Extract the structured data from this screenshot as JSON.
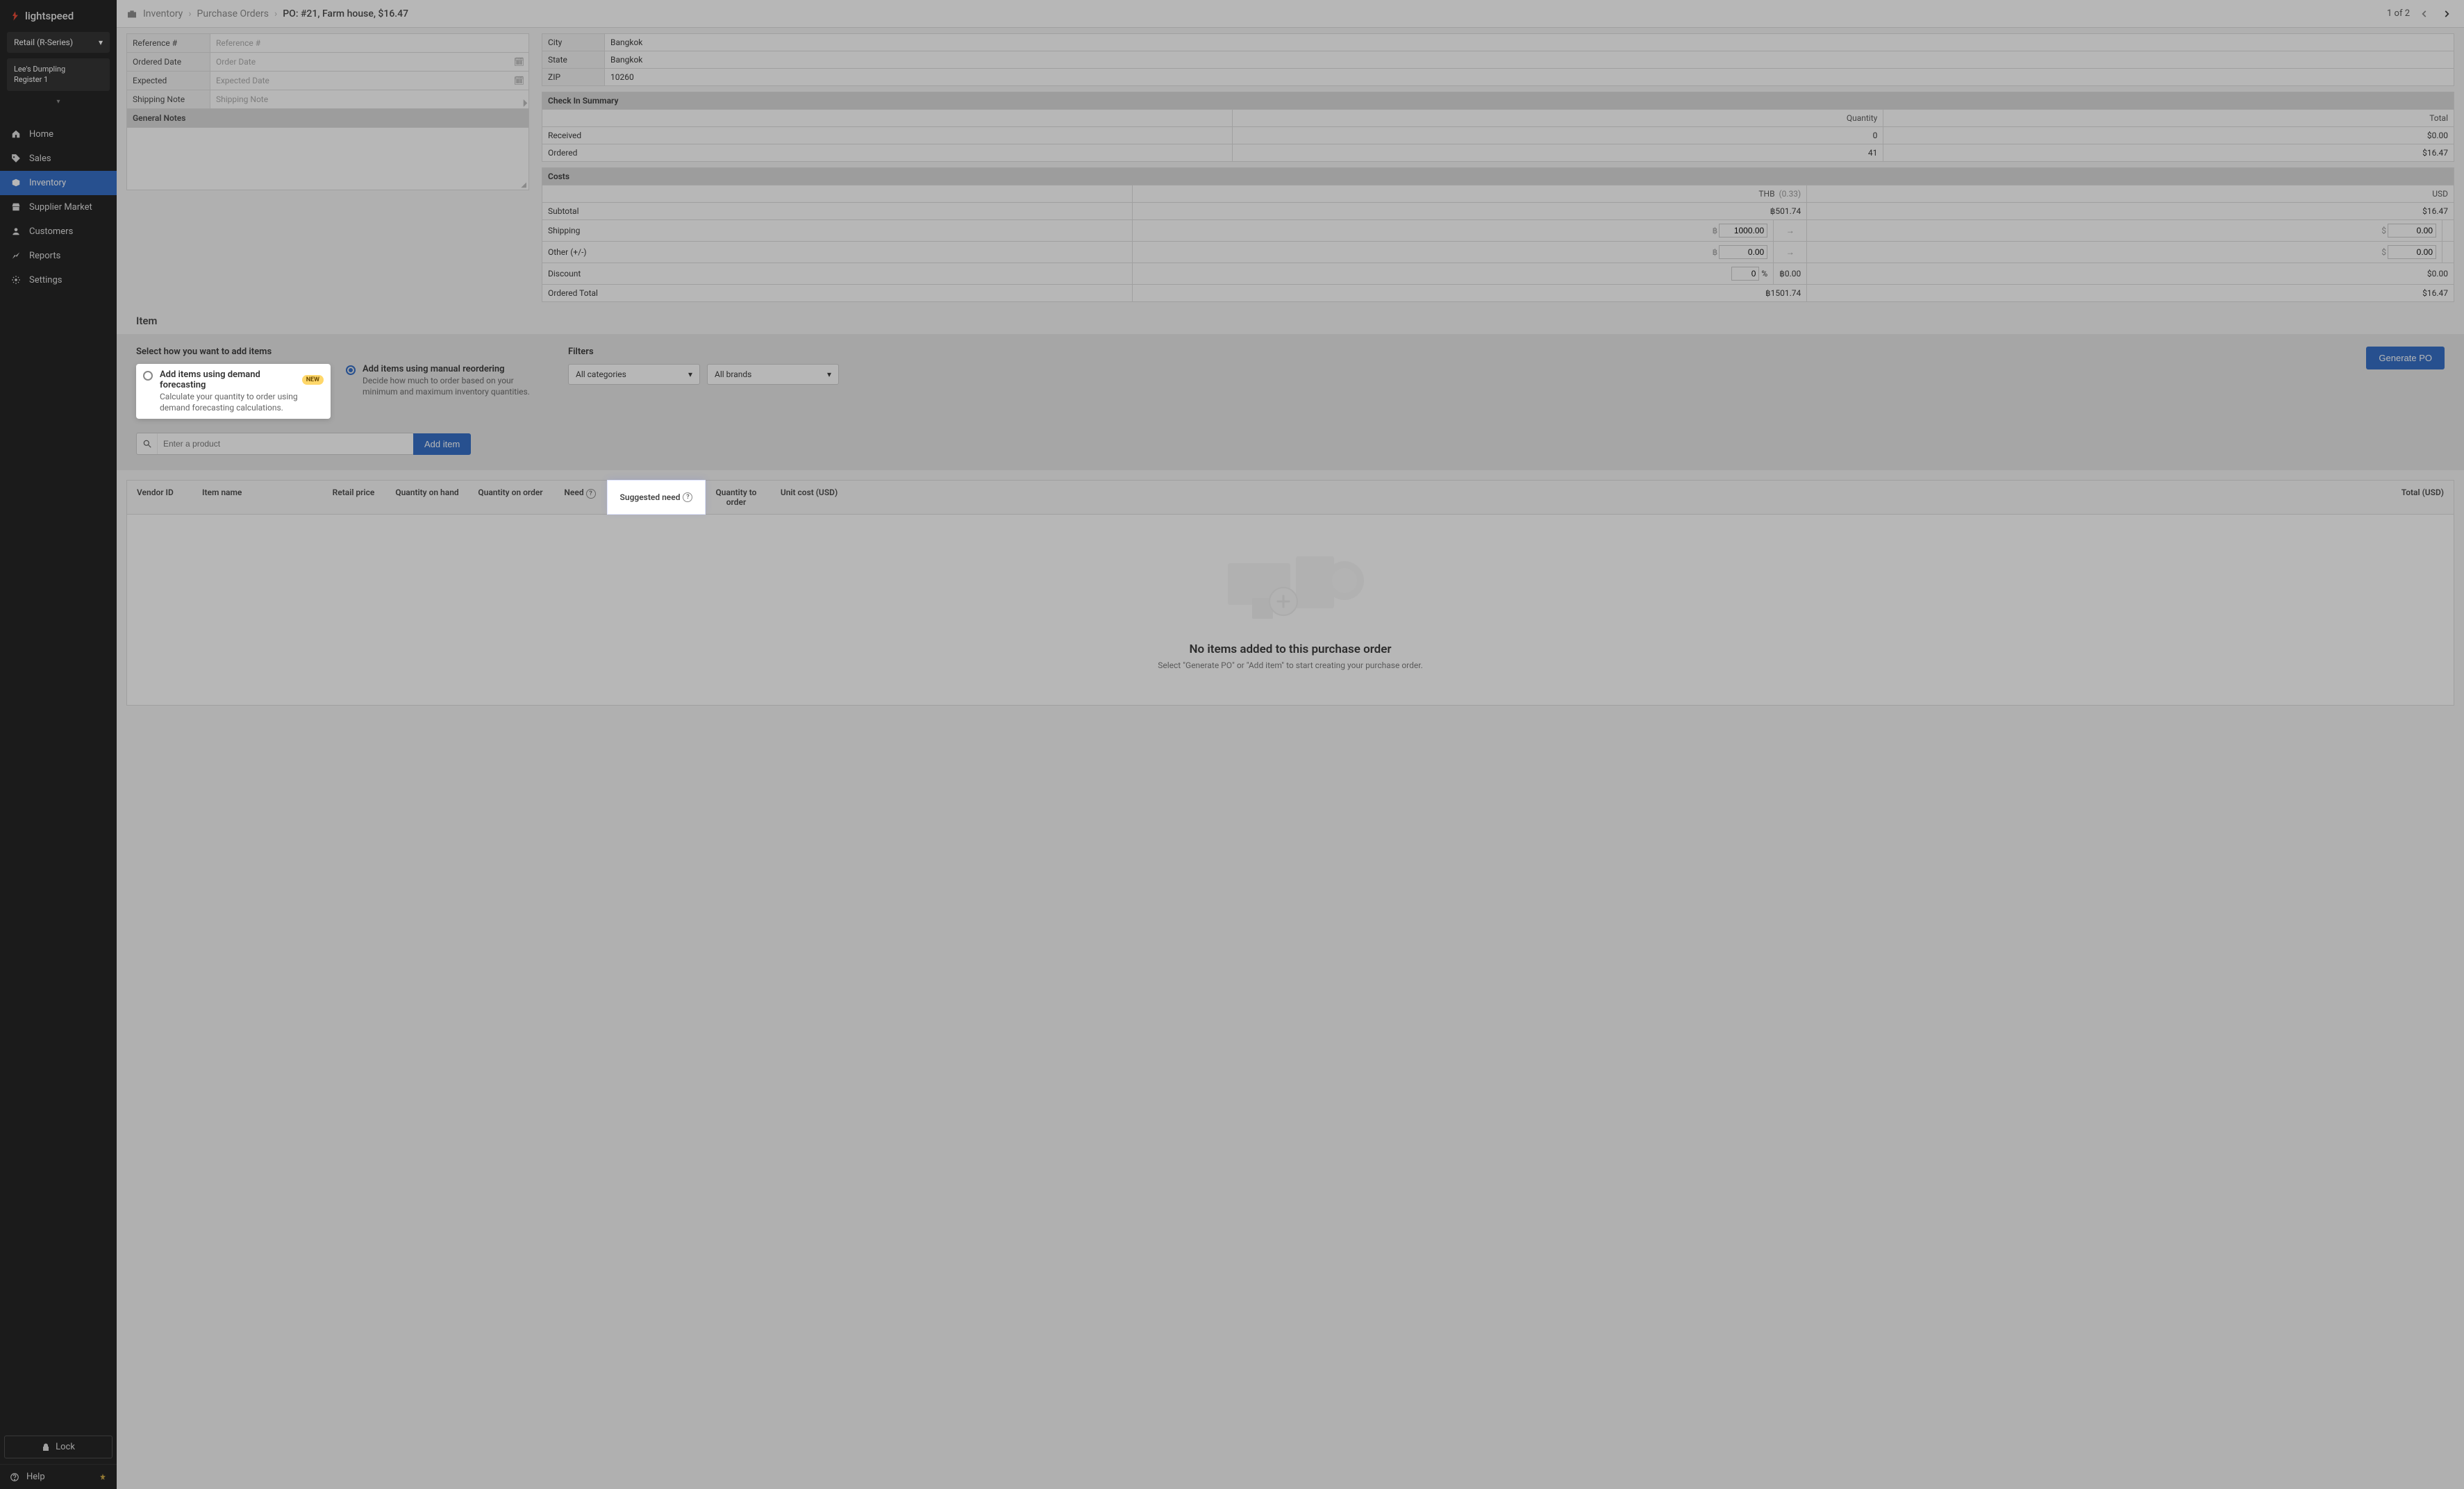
{
  "brand": "lightspeed",
  "retail_dropdown": "Retail (R-Series)",
  "location_name": "Lee's Dumpling",
  "register_name": "Register 1",
  "nav": {
    "home": "Home",
    "sales": "Sales",
    "inventory": "Inventory",
    "supplier_market": "Supplier Market",
    "customers": "Customers",
    "reports": "Reports",
    "settings": "Settings"
  },
  "lock": "Lock",
  "help": "Help",
  "breadcrumbs": {
    "inventory": "Inventory",
    "purchase_orders": "Purchase Orders",
    "current": "PO:  #21, Farm house, $16.47"
  },
  "pagination": "1 of 2",
  "form": {
    "ref_label": "Reference #",
    "ref_placeholder": "Reference #",
    "ordered_label": "Ordered Date",
    "ordered_placeholder": "Order Date",
    "expected_label": "Expected",
    "expected_placeholder": "Expected Date",
    "ship_note_label": "Shipping Note",
    "ship_note_placeholder": "Shipping Note",
    "general_notes_label": "General Notes"
  },
  "address": {
    "city_label": "City",
    "city": "Bangkok",
    "state_label": "State",
    "state": "Bangkok",
    "zip_label": "ZIP",
    "zip": "10260"
  },
  "checkin": {
    "header": "Check In Summary",
    "qty_label": "Quantity",
    "total_label": "Total",
    "received_label": "Received",
    "received_qty": "0",
    "received_total": "$0.00",
    "ordered_label": "Ordered",
    "ordered_qty": "41",
    "ordered_total": "$16.47"
  },
  "costs": {
    "header": "Costs",
    "thb": "THB",
    "thb_rate": "(0.33)",
    "usd": "USD",
    "subtotal_label": "Subtotal",
    "subtotal_thb": "฿501.74",
    "subtotal_usd": "$16.47",
    "shipping_label": "Shipping",
    "shipping_thb": "1000.00",
    "shipping_usd": "0.00",
    "other_label": "Other (+/-)",
    "other_thb": "0.00",
    "other_usd": "0.00",
    "discount_label": "Discount",
    "discount_val": "0",
    "discount_pct": "%",
    "discount_thb": "฿0.00",
    "discount_usd": "$0.00",
    "ordered_total_label": "Ordered Total",
    "ordered_total_thb": "฿1501.74",
    "ordered_total_usd": "$16.47"
  },
  "item_section": {
    "heading": "Item",
    "select_heading": "Select how you want to add items",
    "opt_forecast_title": "Add items using demand forecasting",
    "opt_forecast_badge": "NEW",
    "opt_forecast_desc": "Calculate your quantity to order using demand forecasting calculations.",
    "opt_manual_title": "Add items using manual reordering",
    "opt_manual_desc": "Decide how much to order based on your minimum and maximum inventory quantities.",
    "filters_label": "Filters",
    "all_categories": "All categories",
    "all_brands": "All brands",
    "generate_po": "Generate PO",
    "search_placeholder": "Enter a product",
    "add_item": "Add item"
  },
  "items_header": {
    "vendor_id": "Vendor ID",
    "item_name": "Item name",
    "retail": "Retail price",
    "qoh": "Quantity on hand",
    "qoo": "Quantity on order",
    "need": "Need",
    "suggested_need": "Suggested need",
    "qto": "Quantity to order",
    "unit_cost": "Unit cost (USD)",
    "total": "Total (USD)"
  },
  "empty": {
    "title": "No items added to this purchase order",
    "sub": "Select \"Generate PO\" or \"Add item\" to start creating your purchase order."
  }
}
